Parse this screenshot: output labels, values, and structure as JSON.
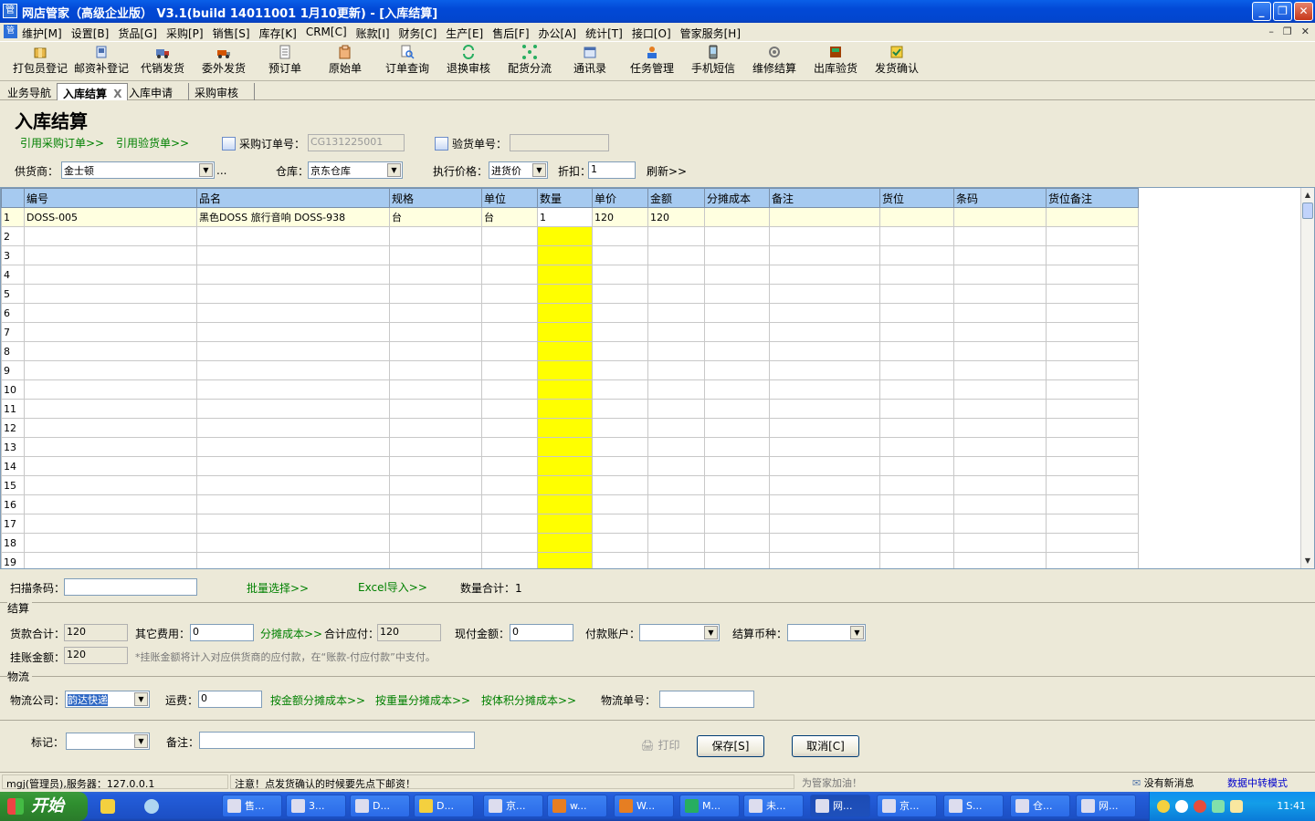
{
  "window": {
    "title": "网店管家（高级企业版） V3.1(build 14011001 1月10更新) - [入库结算]",
    "app_icon": "管",
    "minimize": "_",
    "restore": "❐",
    "close": "✕"
  },
  "menu": {
    "items": [
      "维护[M]",
      "设置[B]",
      "货品[G]",
      "采购[P]",
      "销售[S]",
      "库存[K]",
      "CRM[C]",
      "账款[I]",
      "财务[C]",
      "生产[E]",
      "售后[F]",
      "办公[A]",
      "统计[T]",
      "接口[O]",
      "管家服务[H]"
    ],
    "mdi_min": "–",
    "mdi_restore": "❐",
    "mdi_close": "✕"
  },
  "toolbar": {
    "buttons": [
      {
        "label": "打包员登记",
        "icon": "package-icon"
      },
      {
        "label": "邮资补登记",
        "icon": "postage-icon"
      },
      {
        "label": "代销发货",
        "icon": "truck-icon"
      },
      {
        "label": "委外发货",
        "icon": "outsource-icon"
      },
      {
        "label": "预订单",
        "icon": "document-icon"
      },
      {
        "label": "原始单",
        "icon": "original-order-icon"
      },
      {
        "label": "订单查询",
        "icon": "search-order-icon"
      },
      {
        "label": "退换审核",
        "icon": "exchange-icon"
      },
      {
        "label": "配货分流",
        "icon": "distribute-icon"
      },
      {
        "label": "通讯录",
        "icon": "contacts-icon"
      },
      {
        "label": "任务管理",
        "icon": "task-icon"
      },
      {
        "label": "手机短信",
        "icon": "phone-icon"
      },
      {
        "label": "维修结算",
        "icon": "repair-icon"
      },
      {
        "label": "出库验货",
        "icon": "outbound-check-icon"
      },
      {
        "label": "发货确认",
        "icon": "ship-confirm-icon"
      }
    ]
  },
  "tabs": [
    {
      "label": "业务导航",
      "active": false
    },
    {
      "label": "入库结算",
      "active": true,
      "close": "X"
    },
    {
      "label": "入库申请",
      "active": false
    },
    {
      "label": "采购审核",
      "active": false
    }
  ],
  "form": {
    "page_title": "入库结算",
    "ref_purchase_link": "引用采购订单>>",
    "ref_inspect_link": "引用验货单>>",
    "purchase_order_label": "采购订单号：",
    "purchase_order_value": "CG131225001",
    "inspect_no_label": "验货单号：",
    "inspect_no_value": "",
    "supplier_label": "供货商：",
    "supplier_value": "金士顿",
    "supplier_more": "...",
    "warehouse_label": "仓库：",
    "warehouse_value": "京东仓库",
    "price_label": "执行价格：",
    "price_value": "进货价",
    "discount_label": "折扣：",
    "discount_value": "1",
    "refresh_link": "刷新>>"
  },
  "grid": {
    "columns": [
      "编号",
      "品名",
      "规格",
      "单位",
      "数量",
      "单价",
      "金额",
      "分摊成本",
      "备注",
      "货位",
      "条码",
      "货位备注"
    ],
    "rows": [
      {
        "n": "1",
        "cells": [
          "DOSS-005",
          "黑色DOSS 旅行音响 DOSS-938",
          "台",
          "台",
          "1",
          "120",
          "120",
          "",
          "",
          "",
          "",
          ""
        ]
      }
    ],
    "empty_row_numbers": [
      "2",
      "3",
      "4",
      "5",
      "6",
      "7",
      "8",
      "9",
      "10",
      "11",
      "12",
      "13",
      "14",
      "15",
      "16",
      "17",
      "18",
      "19"
    ],
    "highlight_color": "#ffff00",
    "header_color": "#a6caf0"
  },
  "below_grid": {
    "scan_label": "扫描条码：",
    "scan_value": "",
    "batch_link": "批量选择>>",
    "excel_link": "Excel导入>>",
    "qty_total_label": "数量合计：",
    "qty_total_value": "1"
  },
  "settlement": {
    "section_title": "结算",
    "goods_total_label": "货款合计：",
    "goods_total_value": "120",
    "other_fee_label": "其它费用：",
    "other_fee_value": "0",
    "alloc_link": "分摊成本>>",
    "total_payable_label": "合计应付：",
    "total_payable_value": "120",
    "paid_label": "现付金额：",
    "paid_value": "0",
    "account_label": "付款账户：",
    "account_value": "",
    "currency_label": "结算币种：",
    "currency_value": "",
    "hang_label": "挂账金额：",
    "hang_value": "120",
    "hang_note": "*挂账金额将计入对应供货商的应付款，在“账款-付应付款”中支付。"
  },
  "logistics": {
    "section_title": "物流",
    "company_label": "物流公司：",
    "company_value": "韵达快递",
    "freight_label": "运费：",
    "freight_value": "0",
    "by_amount_link": "按金额分摊成本>>",
    "by_weight_link": "按重量分摊成本>>",
    "by_volume_link": "按体积分摊成本>>",
    "tracking_label": "物流单号：",
    "tracking_value": ""
  },
  "footer_form": {
    "mark_label": "标记：",
    "mark_value": "",
    "remark_label": "备注：",
    "remark_value": "",
    "print_label": "打印",
    "save_label": "保存[S]",
    "cancel_label": "取消[C]"
  },
  "status": {
    "user": "mgj(管理员),服务器：127.0.0.1",
    "notice": "注意！点发货确认的时候要先点下邮资！",
    "slogan": "为管家加油！",
    "messages": "没有新消息",
    "mode": "数据中转模式"
  },
  "taskbar": {
    "start": "开始",
    "tasks": [
      "售...",
      "3...",
      "D...",
      "D...",
      "京...",
      "w...",
      "W...",
      "M...",
      "未...",
      "网...",
      "京...",
      "S...",
      "仓...",
      "网..."
    ],
    "clock": "11:41"
  }
}
